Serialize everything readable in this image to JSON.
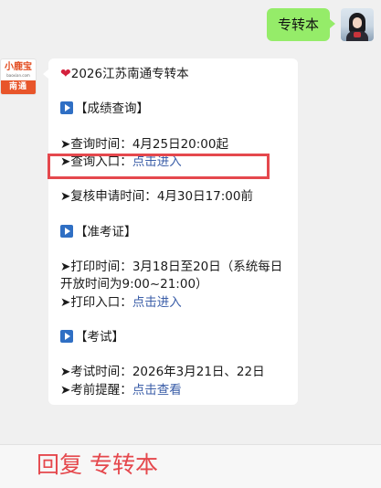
{
  "outgoing": {
    "text": "专转本"
  },
  "brand_avatar": {
    "top": "小鹿宝",
    "middle": "baoxian.com",
    "bottom": "南通"
  },
  "incoming": {
    "title": "2026江苏南通专转本",
    "sections": [
      {
        "header": "【成绩查询】",
        "items": [
          {
            "label": "查询时间：",
            "value": "4月25日20:00起"
          },
          {
            "label": "查询入口：",
            "link": "点击进入"
          },
          {
            "label": "复核申请时间：",
            "value": "4月30日17:00前"
          }
        ]
      },
      {
        "header": "【准考证】",
        "items": [
          {
            "label": "打印时间：",
            "value": "3月18日至20日（系统每日开放时间为9:00~21:00）"
          },
          {
            "label": "打印入口：",
            "link": "点击进入"
          }
        ]
      },
      {
        "header": "【考试】",
        "items": [
          {
            "label": "考试时间：",
            "value": "2026年3月21日、22日"
          },
          {
            "label": "考前提醒：",
            "link": "点击查看"
          }
        ]
      }
    ]
  },
  "reply_bar": {
    "text": "回复 专转本"
  },
  "icons": {
    "heart": "heart-icon",
    "play": "play-button-icon",
    "arrow": "arrow-right-icon"
  },
  "colors": {
    "outgoing_bubble": "#95ec69",
    "link": "#3b5ea8",
    "highlight": "#e5484d",
    "heart": "#d4213d",
    "play": "#2f6fc4"
  }
}
